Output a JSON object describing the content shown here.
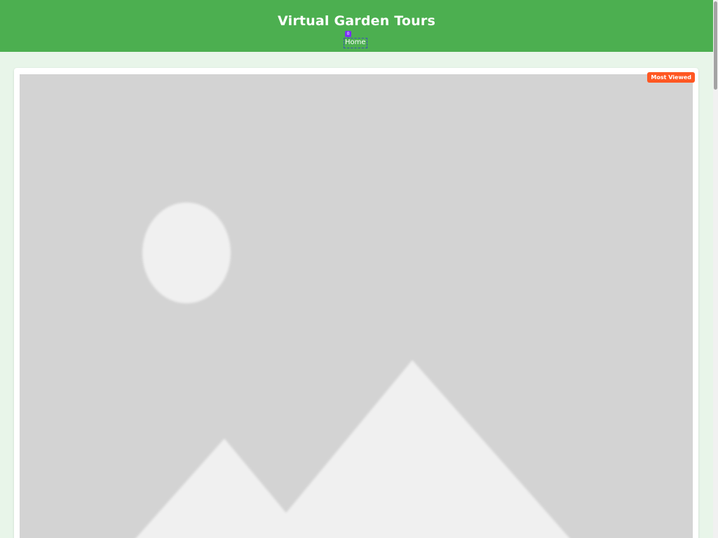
{
  "header": {
    "title": "Virtual Garden Tours",
    "nav": {
      "home_label": "Home",
      "badge_count": "0"
    },
    "colors": {
      "background": "#4caf50",
      "badge": "#7b2ff7"
    }
  },
  "tour_card": {
    "badge_label": "Most Viewed",
    "badge_color": "#ff5722",
    "image_icon": "image-placeholder-icon"
  },
  "page": {
    "background": "#e8f5e9"
  }
}
